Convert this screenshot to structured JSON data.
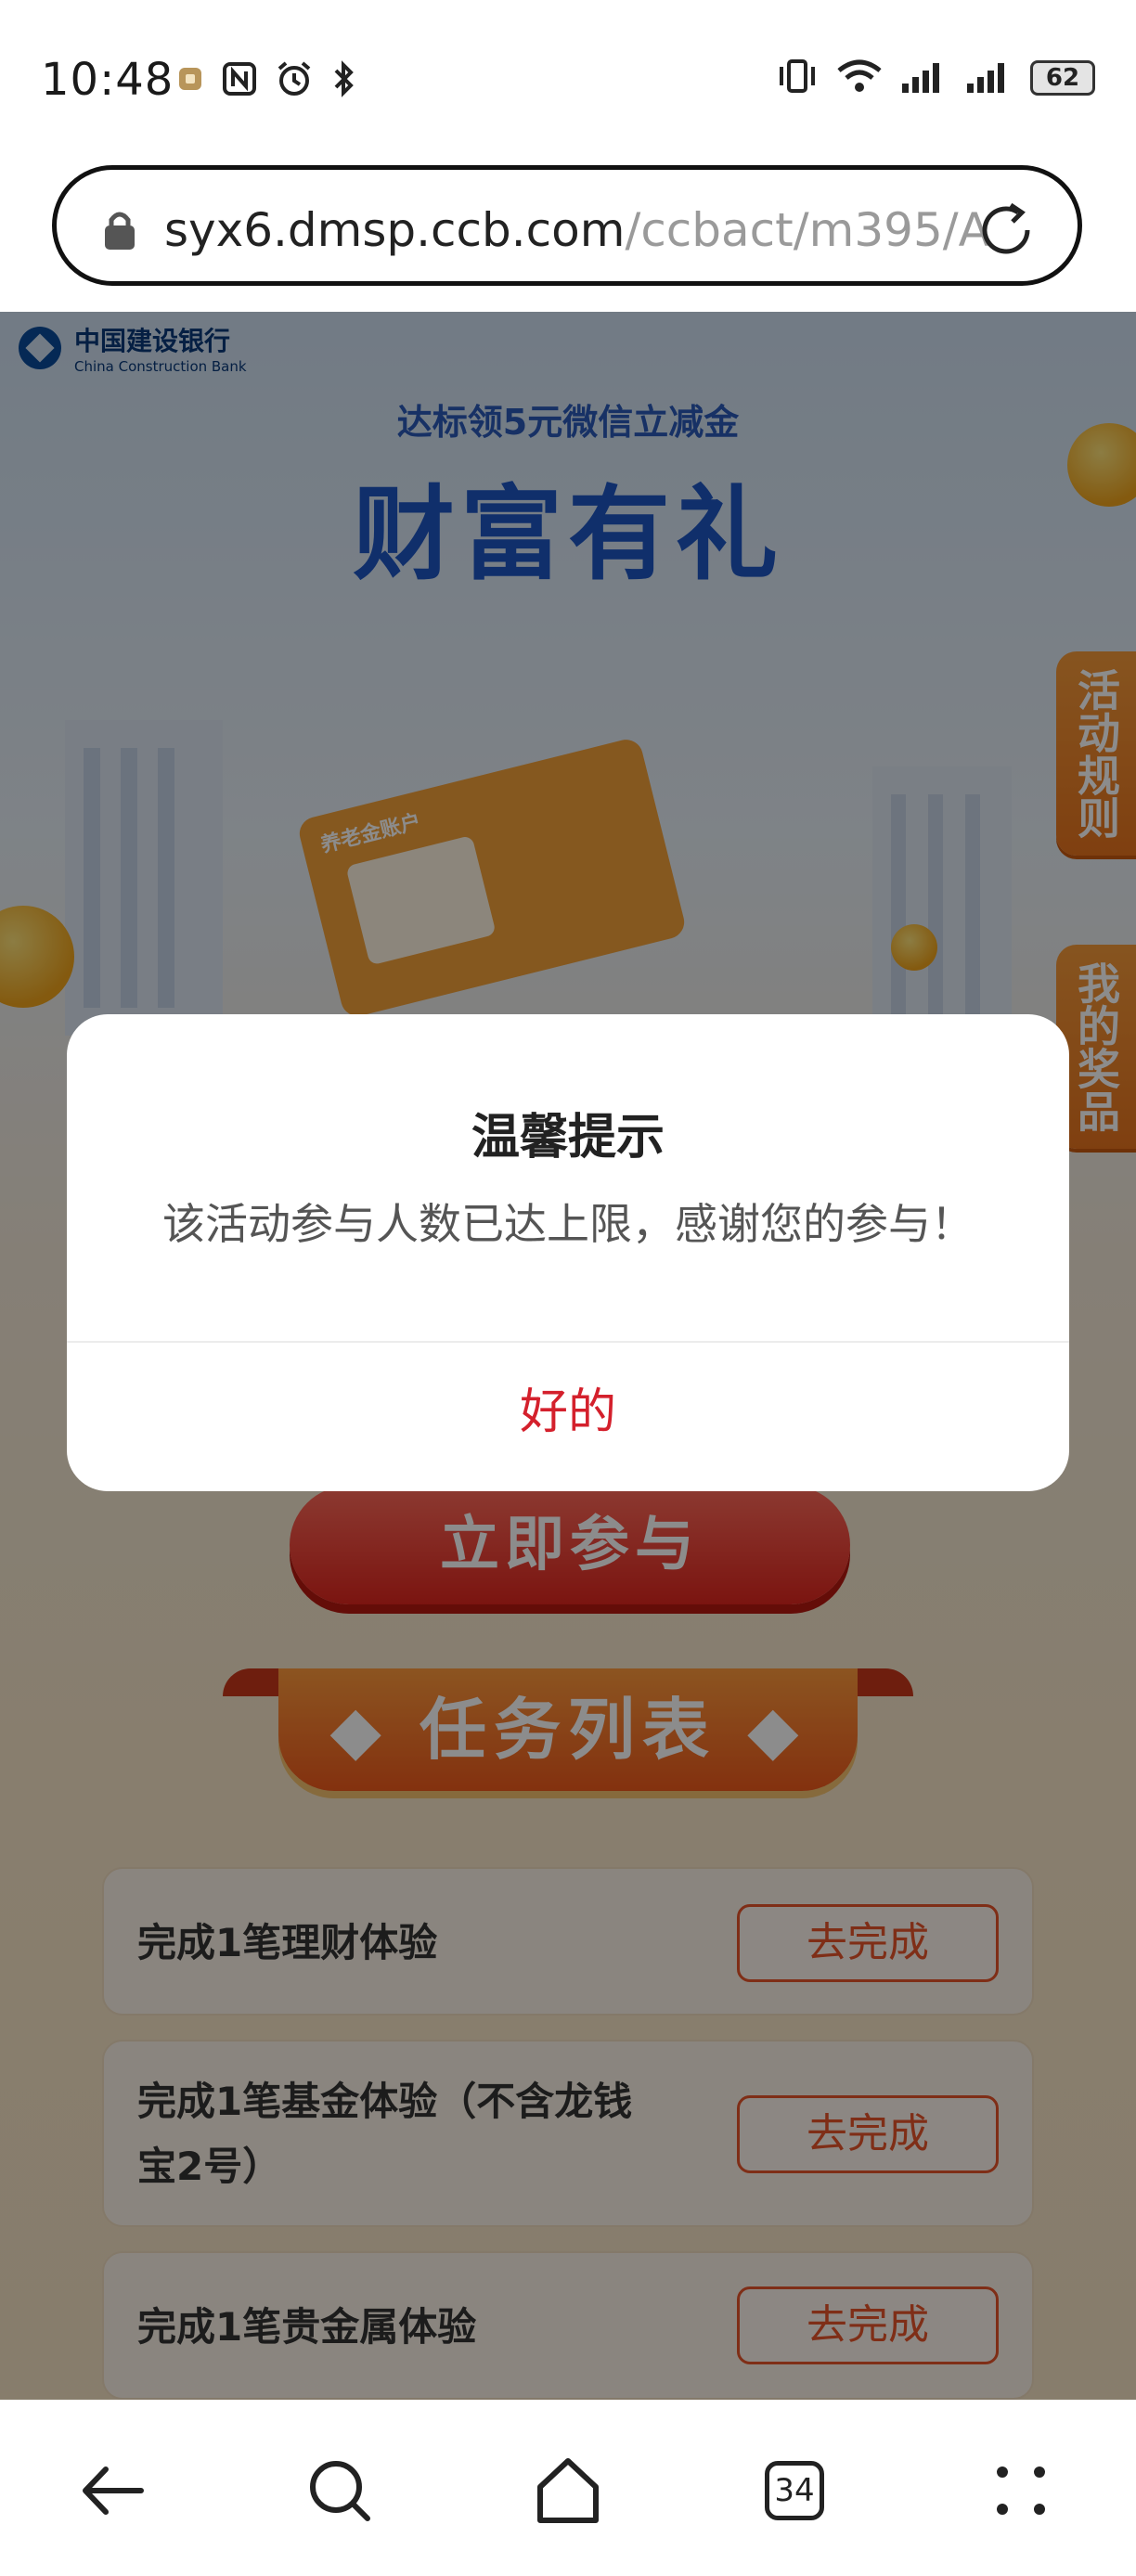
{
  "status_bar": {
    "time": "10:48",
    "battery": "62"
  },
  "browser": {
    "url_host": "syx6.dmsp.ccb.com",
    "url_path": "/ccbact/m395/A",
    "tabs_count": "34"
  },
  "page": {
    "bank_name_cn": "中国建设银行",
    "bank_name_en": "China Construction Bank",
    "subtitle": "达标领5元微信立减金",
    "title": "财富有礼",
    "card_label": "养老金账户",
    "side_tabs": [
      "活动规则",
      "我的奖品"
    ],
    "join_button": "立即参与",
    "task_list_title": "任务列表",
    "tasks": [
      {
        "name": "完成1笔理财体验",
        "action": "去完成"
      },
      {
        "name": "完成1笔基金体验（不含龙钱宝2号）",
        "name_line1": "完成1笔基金体验（不含龙钱",
        "name_line2": "宝2号）",
        "action": "去完成"
      },
      {
        "name": "完成1笔贵金属体验",
        "action": "去完成"
      }
    ]
  },
  "dialog": {
    "title": "温馨提示",
    "message": "该活动参与人数已达上限，感谢您的参与！",
    "ok_label": "好的"
  },
  "colors": {
    "accent_red": "#d4202c",
    "ccb_blue": "#1e56c4",
    "orange": "#e8542a"
  }
}
